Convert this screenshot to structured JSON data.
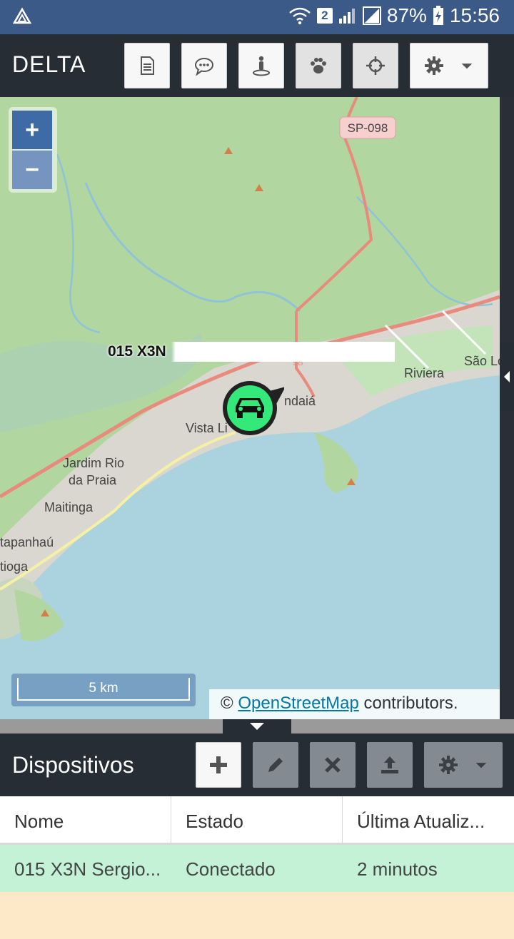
{
  "status_bar": {
    "battery": "87%",
    "time": "15:56",
    "sim_badge": "2"
  },
  "app_bar": {
    "title": "DELTA",
    "buttons": [
      "report-icon",
      "chat-icon",
      "person-pin-icon",
      "paw-icon",
      "crosshair-icon",
      "gear-icon"
    ]
  },
  "map": {
    "zoom_in": "+",
    "zoom_out": "−",
    "scale_label": "5 km",
    "attribution_prefix": "© ",
    "attribution_link": "OpenStreetMap",
    "attribution_suffix": " contributors.",
    "road_label": "SP-098",
    "place_labels": [
      "São Lo",
      "Riviera",
      "Vista Li",
      "ndaiá",
      "Jardim Rio",
      "da Praia",
      "Maitinga",
      "tapanhaú",
      "tioga",
      "98"
    ],
    "marker_label": "015 X3N"
  },
  "devices_panel": {
    "title": "Dispositivos",
    "columns": [
      "Nome",
      "Estado",
      "Última Atualiz..."
    ],
    "rows": [
      {
        "name": "015 X3N Sergio...",
        "state": "Conectado",
        "updated": "2 minutos"
      }
    ]
  },
  "colors": {
    "accent": "#3e6aa6",
    "dark_bar": "#272d35",
    "selected_row": "#c3f2d6",
    "marker": "#34e87a"
  }
}
